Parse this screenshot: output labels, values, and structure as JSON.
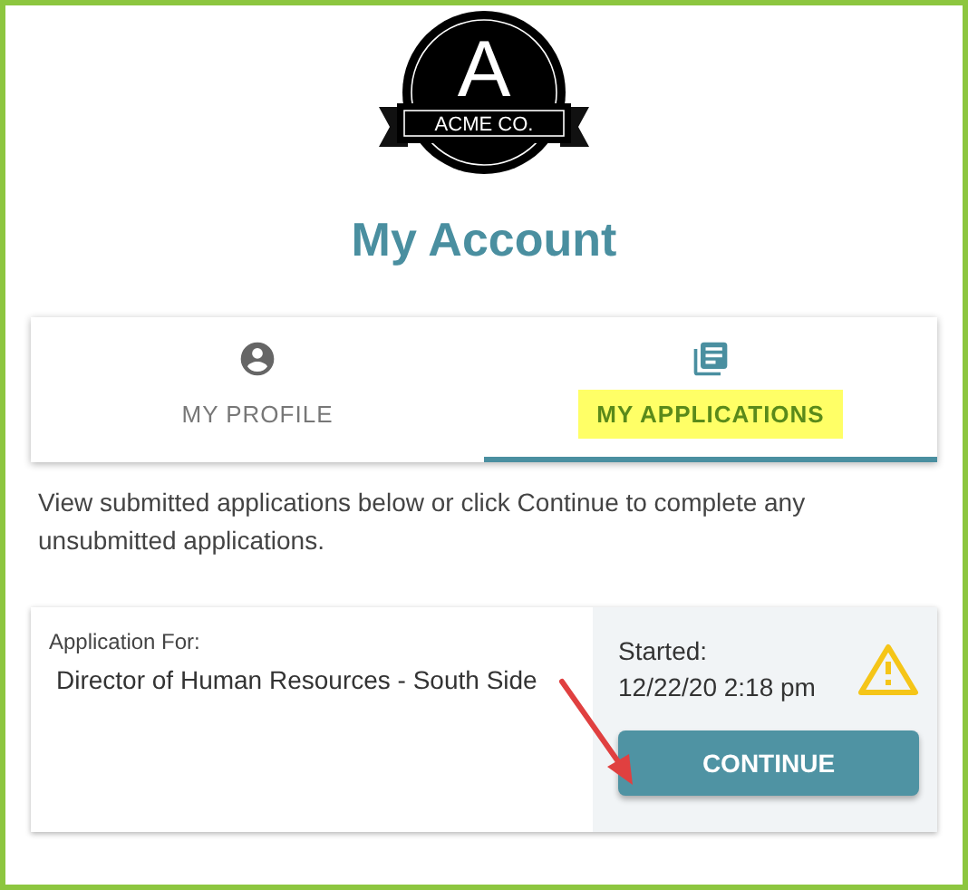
{
  "logo": {
    "letter": "A",
    "name": "ACME CO."
  },
  "title": "My Account",
  "tabs": [
    {
      "label": "MY PROFILE",
      "kind": "profile",
      "selected": false,
      "highlighted": false
    },
    {
      "label": "MY APPLICATIONS",
      "kind": "applications",
      "selected": true,
      "highlighted": true
    }
  ],
  "description": "View submitted applications below or click Continue to complete any unsubmitted applications.",
  "application": {
    "label": "Application For:",
    "position": "Director of Human Resources - South Side",
    "started_label": "Started:",
    "started_date": "12/22/20 2:18 pm",
    "warning": true,
    "button": "CONTINUE"
  }
}
